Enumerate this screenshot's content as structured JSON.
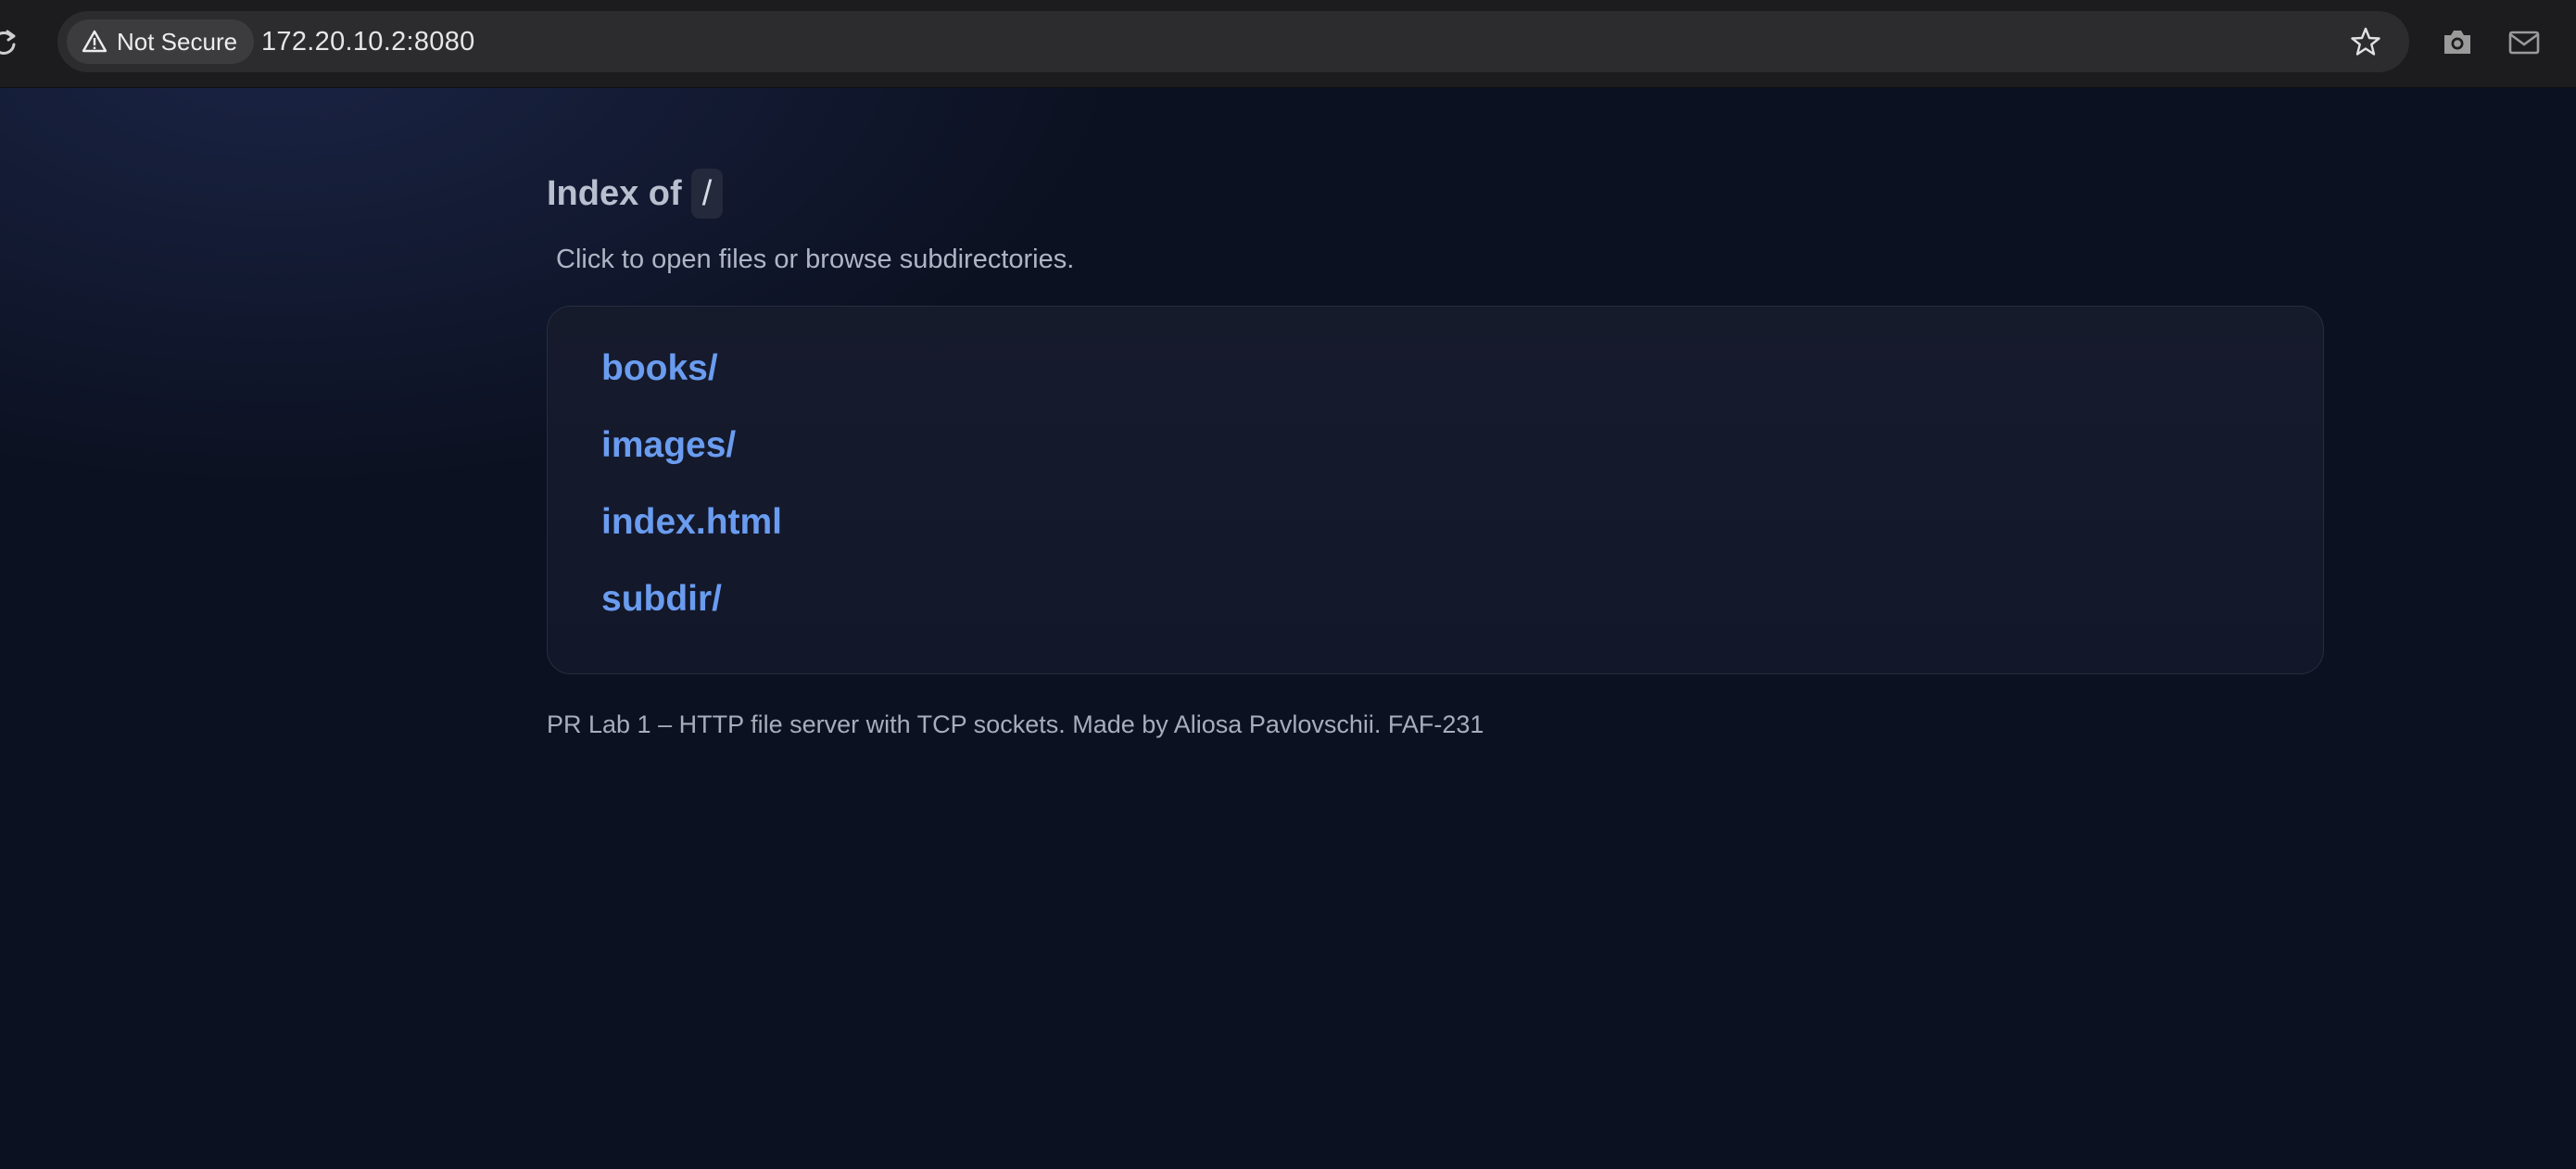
{
  "browser": {
    "security_label": "Not Secure",
    "url": "172.20.10.2:8080",
    "icons": [
      "reload-icon",
      "warning-icon",
      "bookmark-star-icon",
      "camera-icon",
      "mail-icon"
    ]
  },
  "page": {
    "title_prefix": "Index of",
    "path": "/",
    "subtitle": "Click to open files or browse subdirectories.",
    "entries": [
      {
        "label": "books/"
      },
      {
        "label": "images/"
      },
      {
        "label": "index.html"
      },
      {
        "label": "subdir/"
      }
    ],
    "footer": "PR Lab 1 – HTTP file server with TCP sockets. Made by Aliosa Pavlovschii. FAF-231"
  },
  "colors": {
    "background": "#0c1121",
    "link": "#6a9cf0",
    "card": "#161b2c",
    "muted_text": "#aeb5c4"
  }
}
